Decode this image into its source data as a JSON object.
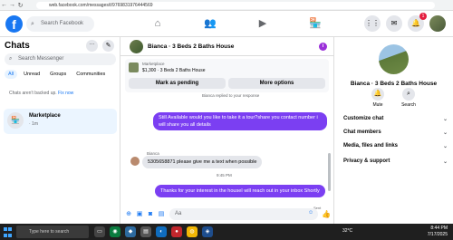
{
  "browser": {
    "url": "web.facebook.com/messages/t/9769831976444569"
  },
  "topnav": {
    "logo": "f",
    "search_placeholder": "Search Facebook",
    "notif_badge": "1"
  },
  "sidebar": {
    "title": "Chats",
    "search_placeholder": "Search Messenger",
    "filters": [
      "All",
      "Unread",
      "Groups",
      "Communities"
    ],
    "notice_text": "Chats aren't backed up.",
    "notice_link": "Fix now",
    "chat": {
      "name": "Marketplace",
      "time": "· 1m"
    }
  },
  "conversation": {
    "title": "Bianca · 3 Beds 2 Baths House",
    "listing_category": "Marketplace",
    "listing_desc": "$1,300 · 3 Beds 2 Baths House",
    "btn_pending": "Mark as pending",
    "btn_more": "More options",
    "cut_text": "Bianca replied to your response",
    "msg1": "Still Available would you like to take it a tour?share you contact number i will share you all details",
    "sender": "Bianca",
    "msg2_number": "5305658871",
    "msg2_text": "please give me a text when possible",
    "timestamp": "9:45 PM",
    "msg3": "Thanks for your interest in the houseI will reach out in your inbox Shortly",
    "sent_label": "Sent",
    "composer_placeholder": "Aa"
  },
  "details": {
    "name": "Bianca · 3 Beds 2 Baths House",
    "mute": "Mute",
    "search": "Search",
    "rows": [
      "Customize chat",
      "Chat members",
      "Media, files and links",
      "Privacy & support"
    ]
  },
  "taskbar": {
    "search_placeholder": "Type here to search",
    "weather": "32°C",
    "time": "8:44 PM",
    "date": "7/17/2025"
  },
  "colors": {
    "accent": "#1877f2",
    "bubble_out": "#7b3ff2"
  }
}
